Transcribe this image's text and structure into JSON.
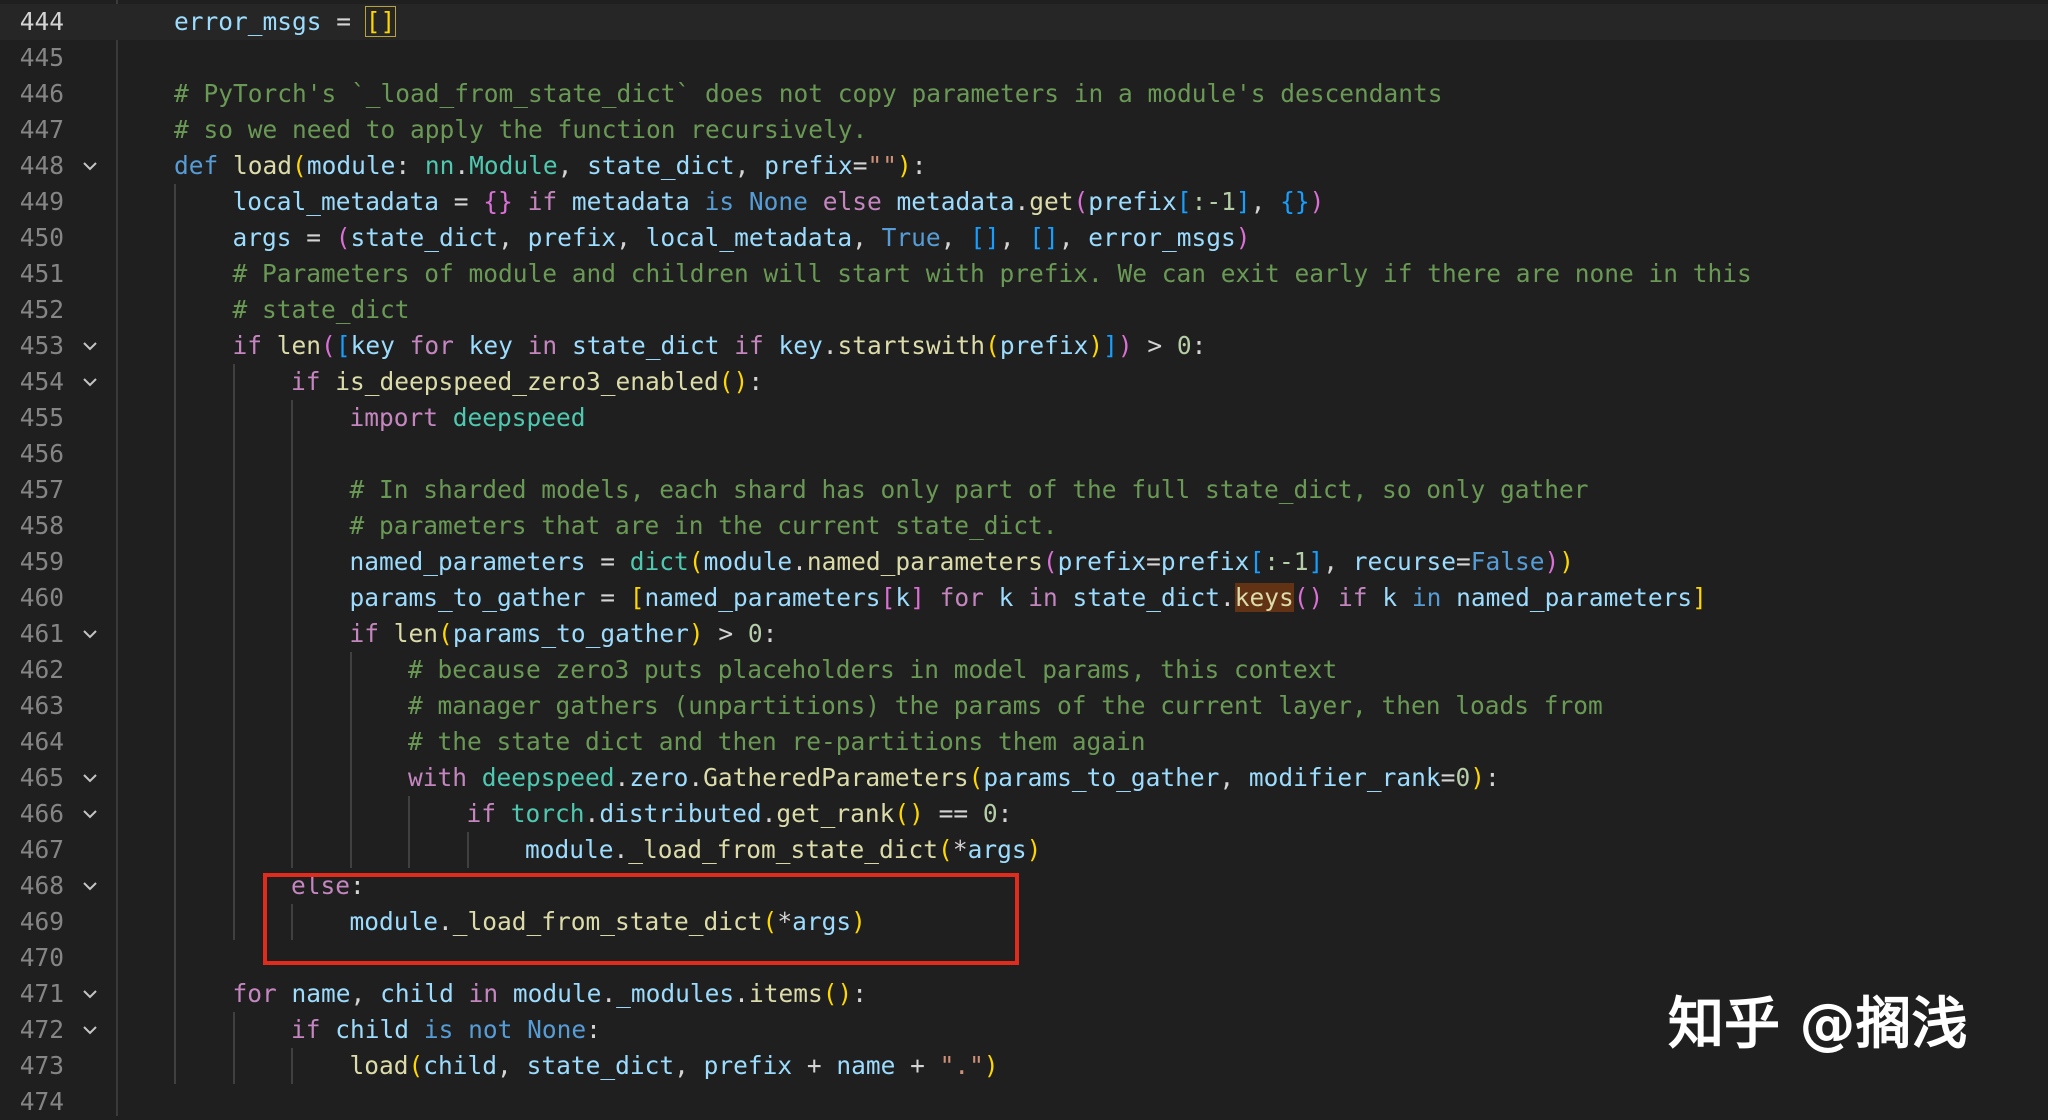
{
  "editor": {
    "current_line": "444",
    "lines": [
      {
        "n": "444",
        "tokens": [
          [
            "error_msgs",
            "var"
          ],
          [
            " = ",
            "plain"
          ],
          [
            "[]",
            "box"
          ]
        ]
      },
      {
        "n": "445",
        "tokens": []
      },
      {
        "n": "446",
        "tokens": [
          [
            "# PyTorch's `_load_from_state_dict` does not copy parameters in a module's descendants",
            "cmt"
          ]
        ]
      },
      {
        "n": "447",
        "tokens": [
          [
            "# so we need to apply the function recursively.",
            "cmt"
          ]
        ]
      },
      {
        "n": "448",
        "fold": true,
        "tokens": [
          [
            "def",
            "kw"
          ],
          [
            " ",
            "plain"
          ],
          [
            "load",
            "fn"
          ],
          [
            "(",
            "b1"
          ],
          [
            "module",
            "var"
          ],
          [
            ": ",
            "plain"
          ],
          [
            "nn",
            "cls"
          ],
          [
            ".",
            "plain"
          ],
          [
            "Module",
            "cls"
          ],
          [
            ", ",
            "plain"
          ],
          [
            "state_dict",
            "var"
          ],
          [
            ", ",
            "plain"
          ],
          [
            "prefix",
            "var"
          ],
          [
            "=",
            "plain"
          ],
          [
            "\"\"",
            "str"
          ],
          [
            ")",
            "b1"
          ],
          [
            ":",
            "plain"
          ]
        ]
      },
      {
        "n": "449",
        "tokens": [
          [
            "local_metadata",
            "var"
          ],
          [
            " = ",
            "plain"
          ],
          [
            "{}",
            "b2"
          ],
          [
            " ",
            "plain"
          ],
          [
            "if",
            "ctrl"
          ],
          [
            " ",
            "plain"
          ],
          [
            "metadata",
            "var"
          ],
          [
            " ",
            "plain"
          ],
          [
            "is",
            "kw"
          ],
          [
            " ",
            "plain"
          ],
          [
            "None",
            "kw"
          ],
          [
            " ",
            "plain"
          ],
          [
            "else",
            "ctrl"
          ],
          [
            " ",
            "plain"
          ],
          [
            "metadata",
            "var"
          ],
          [
            ".",
            "plain"
          ],
          [
            "get",
            "fn"
          ],
          [
            "(",
            "b2"
          ],
          [
            "prefix",
            "var"
          ],
          [
            "[",
            "b3"
          ],
          [
            ":-1",
            "num"
          ],
          [
            "]",
            "b3"
          ],
          [
            ", ",
            "plain"
          ],
          [
            "{}",
            "b3"
          ],
          [
            ")",
            "b2"
          ]
        ]
      },
      {
        "n": "450",
        "tokens": [
          [
            "args",
            "var"
          ],
          [
            " = ",
            "plain"
          ],
          [
            "(",
            "b2"
          ],
          [
            "state_dict",
            "var"
          ],
          [
            ", ",
            "plain"
          ],
          [
            "prefix",
            "var"
          ],
          [
            ", ",
            "plain"
          ],
          [
            "local_metadata",
            "var"
          ],
          [
            ", ",
            "plain"
          ],
          [
            "True",
            "kw"
          ],
          [
            ", ",
            "plain"
          ],
          [
            "[]",
            "b3"
          ],
          [
            ", ",
            "plain"
          ],
          [
            "[]",
            "b3"
          ],
          [
            ", ",
            "plain"
          ],
          [
            "error_msgs",
            "var"
          ],
          [
            ")",
            "b2"
          ]
        ]
      },
      {
        "n": "451",
        "tokens": [
          [
            "# Parameters of module and children will start with prefix. We can exit early if there are none in this",
            "cmt"
          ]
        ]
      },
      {
        "n": "452",
        "tokens": [
          [
            "# state_dict",
            "cmt"
          ]
        ]
      },
      {
        "n": "453",
        "fold": true,
        "tokens": [
          [
            "if",
            "ctrl"
          ],
          [
            " ",
            "plain"
          ],
          [
            "len",
            "fn"
          ],
          [
            "(",
            "b2"
          ],
          [
            "[",
            "b3"
          ],
          [
            "key",
            "var"
          ],
          [
            " ",
            "plain"
          ],
          [
            "for",
            "ctrl"
          ],
          [
            " ",
            "plain"
          ],
          [
            "key",
            "var"
          ],
          [
            " ",
            "plain"
          ],
          [
            "in",
            "ctrl"
          ],
          [
            " ",
            "plain"
          ],
          [
            "state_dict",
            "var"
          ],
          [
            " ",
            "plain"
          ],
          [
            "if",
            "ctrl"
          ],
          [
            " ",
            "plain"
          ],
          [
            "key",
            "var"
          ],
          [
            ".",
            "plain"
          ],
          [
            "startswith",
            "fn"
          ],
          [
            "(",
            "b1"
          ],
          [
            "prefix",
            "var"
          ],
          [
            ")",
            "b1"
          ],
          [
            "]",
            "b3"
          ],
          [
            ")",
            "b2"
          ],
          [
            " > ",
            "plain"
          ],
          [
            "0",
            "num"
          ],
          [
            ":",
            "plain"
          ]
        ]
      },
      {
        "n": "454",
        "fold": true,
        "tokens": [
          [
            "if",
            "ctrl"
          ],
          [
            " ",
            "plain"
          ],
          [
            "is_deepspeed_zero3_enabled",
            "fn"
          ],
          [
            "()",
            "b1"
          ],
          [
            ":",
            "plain"
          ]
        ]
      },
      {
        "n": "455",
        "tokens": [
          [
            "import",
            "ctrl"
          ],
          [
            " ",
            "plain"
          ],
          [
            "deepspeed",
            "cls"
          ]
        ]
      },
      {
        "n": "456",
        "tokens": []
      },
      {
        "n": "457",
        "tokens": [
          [
            "# In sharded models, each shard has only part of the full state_dict, so only gather",
            "cmt"
          ]
        ]
      },
      {
        "n": "458",
        "tokens": [
          [
            "# parameters that are in the current state_dict.",
            "cmt"
          ]
        ]
      },
      {
        "n": "459",
        "tokens": [
          [
            "named_parameters",
            "var"
          ],
          [
            " = ",
            "plain"
          ],
          [
            "dict",
            "cls"
          ],
          [
            "(",
            "b1"
          ],
          [
            "module",
            "var"
          ],
          [
            ".",
            "plain"
          ],
          [
            "named_parameters",
            "fn"
          ],
          [
            "(",
            "b2"
          ],
          [
            "prefix",
            "var"
          ],
          [
            "=",
            "plain"
          ],
          [
            "prefix",
            "var"
          ],
          [
            "[",
            "b3"
          ],
          [
            ":-1",
            "num"
          ],
          [
            "]",
            "b3"
          ],
          [
            ", ",
            "plain"
          ],
          [
            "recurse",
            "var"
          ],
          [
            "=",
            "plain"
          ],
          [
            "False",
            "kw"
          ],
          [
            ")",
            "b2"
          ],
          [
            ")",
            "b1"
          ]
        ]
      },
      {
        "n": "460",
        "tokens": [
          [
            "params_to_gather",
            "var"
          ],
          [
            " = ",
            "plain"
          ],
          [
            "[",
            "b1"
          ],
          [
            "named_parameters",
            "var"
          ],
          [
            "[",
            "b2"
          ],
          [
            "k",
            "var"
          ],
          [
            "]",
            "b2"
          ],
          [
            " ",
            "plain"
          ],
          [
            "for",
            "ctrl"
          ],
          [
            " ",
            "plain"
          ],
          [
            "k",
            "var"
          ],
          [
            " ",
            "plain"
          ],
          [
            "in",
            "ctrl"
          ],
          [
            " ",
            "plain"
          ],
          [
            "state_dict",
            "var"
          ],
          [
            ".",
            "plain"
          ],
          [
            "keys",
            "hl"
          ],
          [
            "()",
            "b2"
          ],
          [
            " ",
            "plain"
          ],
          [
            "if",
            "ctrl"
          ],
          [
            " ",
            "plain"
          ],
          [
            "k",
            "var"
          ],
          [
            " ",
            "plain"
          ],
          [
            "in",
            "kw"
          ],
          [
            " ",
            "plain"
          ],
          [
            "named_parameters",
            "var"
          ],
          [
            "]",
            "b1"
          ]
        ]
      },
      {
        "n": "461",
        "fold": true,
        "tokens": [
          [
            "if",
            "ctrl"
          ],
          [
            " ",
            "plain"
          ],
          [
            "len",
            "fn"
          ],
          [
            "(",
            "b1"
          ],
          [
            "params_to_gather",
            "var"
          ],
          [
            ")",
            "b1"
          ],
          [
            " > ",
            "plain"
          ],
          [
            "0",
            "num"
          ],
          [
            ":",
            "plain"
          ]
        ]
      },
      {
        "n": "462",
        "tokens": [
          [
            "# because zero3 puts placeholders in model params, this context",
            "cmt"
          ]
        ]
      },
      {
        "n": "463",
        "tokens": [
          [
            "# manager gathers (unpartitions) the params of the current layer, then loads from",
            "cmt"
          ]
        ]
      },
      {
        "n": "464",
        "tokens": [
          [
            "# the state dict and then re-partitions them again",
            "cmt"
          ]
        ]
      },
      {
        "n": "465",
        "fold": true,
        "tokens": [
          [
            "with",
            "ctrl"
          ],
          [
            " ",
            "plain"
          ],
          [
            "deepspeed",
            "cls"
          ],
          [
            ".",
            "plain"
          ],
          [
            "zero",
            "var"
          ],
          [
            ".",
            "plain"
          ],
          [
            "GatheredParameters",
            "fn"
          ],
          [
            "(",
            "b1"
          ],
          [
            "params_to_gather",
            "var"
          ],
          [
            ", ",
            "plain"
          ],
          [
            "modifier_rank",
            "var"
          ],
          [
            "=",
            "plain"
          ],
          [
            "0",
            "num"
          ],
          [
            ")",
            "b1"
          ],
          [
            ":",
            "plain"
          ]
        ]
      },
      {
        "n": "466",
        "fold": true,
        "tokens": [
          [
            "if",
            "ctrl"
          ],
          [
            " ",
            "plain"
          ],
          [
            "torch",
            "cls"
          ],
          [
            ".",
            "plain"
          ],
          [
            "distributed",
            "var"
          ],
          [
            ".",
            "plain"
          ],
          [
            "get_rank",
            "fn"
          ],
          [
            "()",
            "b1"
          ],
          [
            " == ",
            "plain"
          ],
          [
            "0",
            "num"
          ],
          [
            ":",
            "plain"
          ]
        ]
      },
      {
        "n": "467",
        "tokens": [
          [
            "module",
            "var"
          ],
          [
            ".",
            "plain"
          ],
          [
            "_load_from_state_dict",
            "fn"
          ],
          [
            "(",
            "b1"
          ],
          [
            "*",
            "plain"
          ],
          [
            "args",
            "var"
          ],
          [
            ")",
            "b1"
          ]
        ]
      },
      {
        "n": "468",
        "fold": true,
        "tokens": [
          [
            "else",
            "ctrl"
          ],
          [
            ":",
            "plain"
          ]
        ]
      },
      {
        "n": "469",
        "tokens": [
          [
            "module",
            "var"
          ],
          [
            ".",
            "plain"
          ],
          [
            "_load_from_state_dict",
            "fn"
          ],
          [
            "(",
            "b1"
          ],
          [
            "*",
            "plain"
          ],
          [
            "args",
            "var"
          ],
          [
            ")",
            "b1"
          ]
        ]
      },
      {
        "n": "470",
        "tokens": []
      },
      {
        "n": "471",
        "fold": true,
        "tokens": [
          [
            "for",
            "ctrl"
          ],
          [
            " ",
            "plain"
          ],
          [
            "name",
            "var"
          ],
          [
            ", ",
            "plain"
          ],
          [
            "child",
            "var"
          ],
          [
            " ",
            "plain"
          ],
          [
            "in",
            "ctrl"
          ],
          [
            " ",
            "plain"
          ],
          [
            "module",
            "var"
          ],
          [
            ".",
            "plain"
          ],
          [
            "_modules",
            "var"
          ],
          [
            ".",
            "plain"
          ],
          [
            "items",
            "fn"
          ],
          [
            "()",
            "b1"
          ],
          [
            ":",
            "plain"
          ]
        ]
      },
      {
        "n": "472",
        "fold": true,
        "tokens": [
          [
            "if",
            "ctrl"
          ],
          [
            " ",
            "plain"
          ],
          [
            "child",
            "var"
          ],
          [
            " ",
            "plain"
          ],
          [
            "is",
            "kw"
          ],
          [
            " ",
            "plain"
          ],
          [
            "not",
            "kw"
          ],
          [
            " ",
            "plain"
          ],
          [
            "None",
            "kw"
          ],
          [
            ":",
            "plain"
          ]
        ]
      },
      {
        "n": "473",
        "tokens": [
          [
            "load",
            "fn"
          ],
          [
            "(",
            "b1"
          ],
          [
            "child",
            "var"
          ],
          [
            ", ",
            "plain"
          ],
          [
            "state_dict",
            "var"
          ],
          [
            ", ",
            "plain"
          ],
          [
            "prefix",
            "var"
          ],
          [
            " + ",
            "plain"
          ],
          [
            "name",
            "var"
          ],
          [
            " + ",
            "plain"
          ],
          [
            "\".\"",
            "str"
          ],
          [
            ")",
            "b1"
          ]
        ]
      },
      {
        "n": "474",
        "tokens": []
      }
    ]
  },
  "watermark": {
    "text": "知乎 @搁浅"
  },
  "colors": {
    "highlight_box": "#e02b1d",
    "background": "#1f1f1f"
  }
}
